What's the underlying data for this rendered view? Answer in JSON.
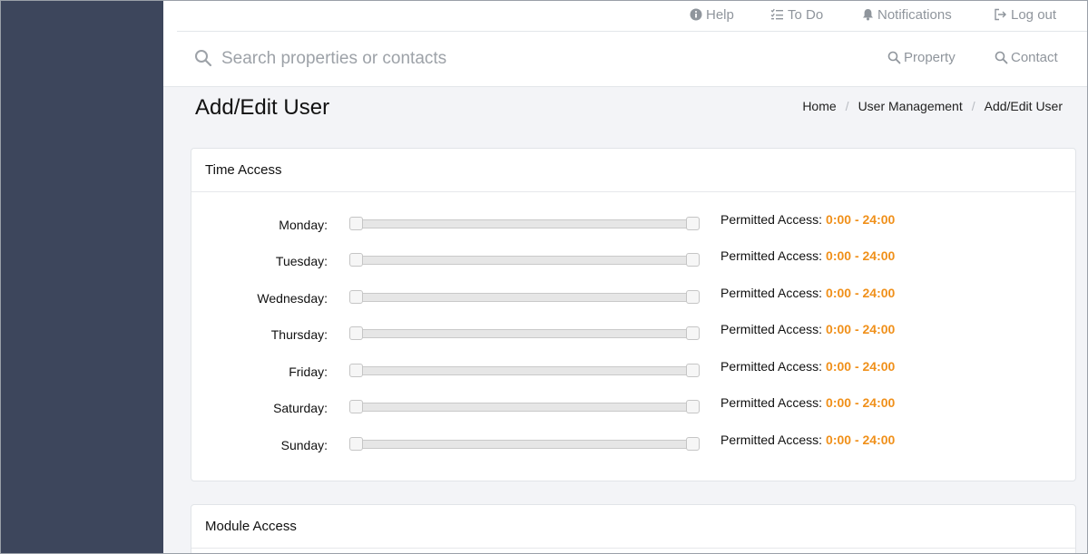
{
  "header": {
    "links": [
      {
        "label": "Help",
        "icon": "info-circle-icon"
      },
      {
        "label": "To Do",
        "icon": "checklist-icon"
      },
      {
        "label": "Notifications",
        "icon": "bell-icon"
      },
      {
        "label": "Log out",
        "icon": "logout-icon"
      }
    ],
    "search": {
      "placeholder": "Search properties or contacts",
      "value": ""
    },
    "quick_search": [
      {
        "label": "Property",
        "icon": "search-icon"
      },
      {
        "label": "Contact",
        "icon": "search-icon"
      }
    ]
  },
  "page": {
    "title": "Add/Edit User",
    "breadcrumb": [
      "Home",
      "User Management",
      "Add/Edit User"
    ]
  },
  "time_access": {
    "title": "Time Access",
    "permitted_label": "Permitted Access:",
    "days": [
      {
        "label": "Monday:",
        "range": "0:00 - 24:00",
        "start": 0,
        "end": 24
      },
      {
        "label": "Tuesday:",
        "range": "0:00 - 24:00",
        "start": 0,
        "end": 24
      },
      {
        "label": "Wednesday:",
        "range": "0:00 - 24:00",
        "start": 0,
        "end": 24
      },
      {
        "label": "Thursday:",
        "range": "0:00 - 24:00",
        "start": 0,
        "end": 24
      },
      {
        "label": "Friday:",
        "range": "0:00 - 24:00",
        "start": 0,
        "end": 24
      },
      {
        "label": "Saturday:",
        "range": "0:00 - 24:00",
        "start": 0,
        "end": 24
      },
      {
        "label": "Sunday:",
        "range": "0:00 - 24:00",
        "start": 0,
        "end": 24
      }
    ]
  },
  "module_access": {
    "title": "Module Access"
  },
  "colors": {
    "sidebar": "#3d465c",
    "accent_orange": "#f0901a",
    "muted_text": "#8f959c"
  }
}
